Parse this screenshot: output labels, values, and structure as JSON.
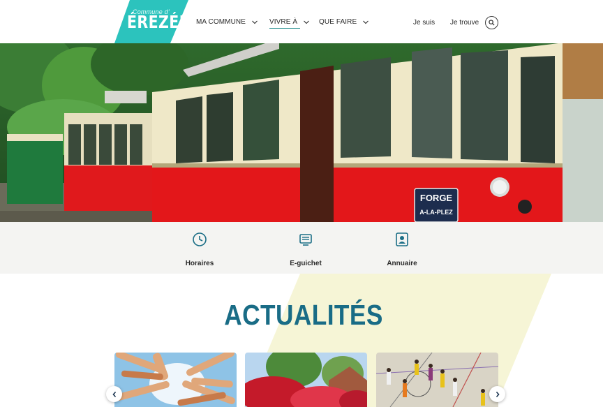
{
  "brand": {
    "prefix": "Commune d'",
    "name": "ÉREZÉE",
    "color": "#2cc3bd"
  },
  "nav": {
    "items": [
      {
        "label": "MA COMMUNE",
        "active": false
      },
      {
        "label": "VIVRE À",
        "active": true
      },
      {
        "label": "QUE FAIRE",
        "active": false
      }
    ],
    "je_suis": "Je suis",
    "je_trouve": "Je trouve",
    "search_icon": "search-icon"
  },
  "hero": {
    "plate_line1": "FORGE",
    "plate_line2": "A-LA-PLEZ"
  },
  "quick_links": [
    {
      "label": "Horaires",
      "icon": "clock-icon"
    },
    {
      "label": "E-guichet",
      "icon": "counter-screen-icon"
    },
    {
      "label": "Annuaire",
      "icon": "contact-card-icon"
    }
  ],
  "news": {
    "title": "ACTUALITÉS",
    "accent_color": "#196c86",
    "prev_icon": "chevron-left-icon",
    "next_icon": "chevron-right-icon"
  }
}
